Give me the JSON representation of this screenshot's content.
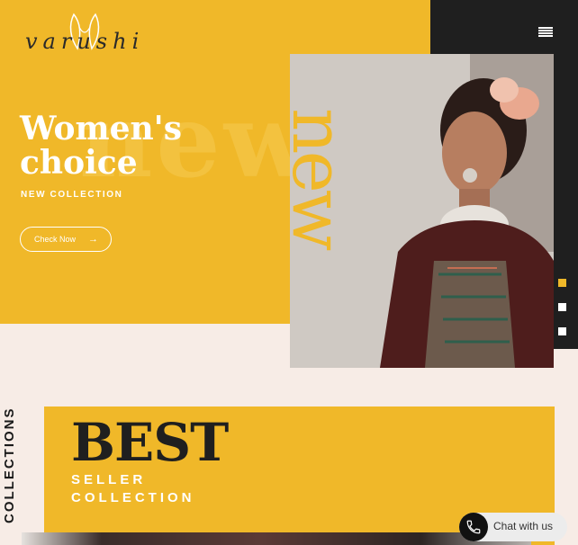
{
  "brand": {
    "logo_text": "varushi"
  },
  "hero": {
    "ghost_word": "new",
    "title_line1": "Women's",
    "title_line2": "choice",
    "subtitle": "NEW COLLECTION",
    "cta_label": "Check Now",
    "cta_icon": "arrow-right-icon",
    "vertical_word": "new",
    "slides_total": 3,
    "active_slide": 1
  },
  "sections": {
    "side_label": "COLLECTIONS",
    "best_title": "BEST",
    "best_sub_line1": "SELLER",
    "best_sub_line2": "COLLECTION"
  },
  "chat": {
    "label": "Chat with us",
    "icon": "phone-icon"
  },
  "colors": {
    "accent": "#f0b829",
    "dark": "#1f1f1f",
    "background": "#f7ece6"
  }
}
